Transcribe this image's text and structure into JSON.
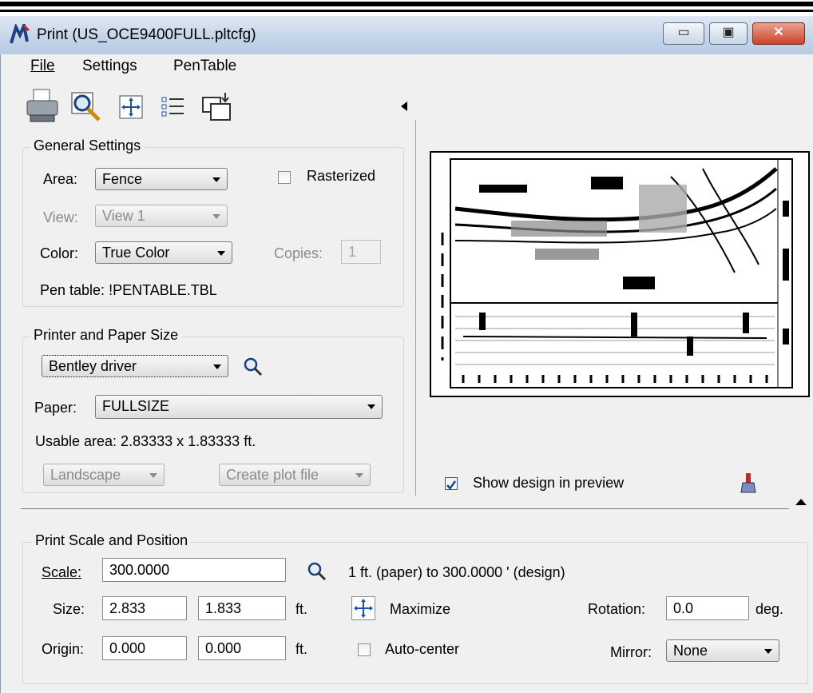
{
  "window": {
    "title": "Print  (US_OCE9400FULL.pltcfg)"
  },
  "menu": {
    "file": "File",
    "settings": "Settings",
    "pentable": "PenTable"
  },
  "general": {
    "title": "General Settings",
    "area_label": "Area:",
    "area_value": "Fence",
    "rasterized_label": "Rasterized",
    "view_label": "View:",
    "view_value": "View 1",
    "color_label": "Color:",
    "color_value": "True Color",
    "copies_label": "Copies:",
    "copies_value": "1",
    "pentable_text": "Pen table:   !PENTABLE.TBL"
  },
  "printer": {
    "title": "Printer and Paper Size",
    "driver": "Bentley driver",
    "paper_label": "Paper:",
    "paper_value": "FULLSIZE",
    "usable_area": "Usable area:  2.83333 x 1.83333 ft.",
    "orientation": "Landscape",
    "output": "Create plot file"
  },
  "preview": {
    "show_design_label": "Show design in preview"
  },
  "scale": {
    "title": "Print Scale and Position",
    "scale_label": "Scale:",
    "scale_value": "300.0000",
    "scale_text": "1 ft. (paper) to 300.0000 ' (design)",
    "size_label": "Size:",
    "size_w": "2.833",
    "size_h": "1.833",
    "size_unit": "ft.",
    "maximize": "Maximize",
    "rotation_label": "Rotation:",
    "rotation_value": "0.0",
    "rotation_unit": "deg.",
    "origin_label": "Origin:",
    "origin_x": "0.000",
    "origin_y": "0.000",
    "origin_unit": "ft.",
    "autocenter_label": "Auto-center",
    "mirror_label": "Mirror:",
    "mirror_value": "None"
  }
}
